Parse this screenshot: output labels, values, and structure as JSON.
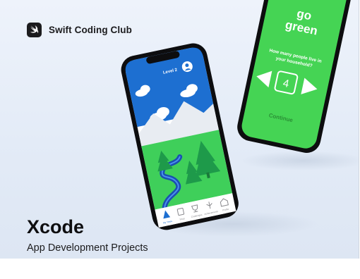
{
  "brand": {
    "name": "Swift Coding Club",
    "logo_icon": "swift-bird-icon"
  },
  "title": "Xcode",
  "subtitle": "App Development Projects",
  "back_phone": {
    "logo_line1": "go",
    "logo_line2": "green",
    "question_line1": "How many people live in",
    "question_line2": "your household?",
    "stepper_value": "4",
    "continue_label": "Continue",
    "screen_color": "#45d454"
  },
  "front_phone": {
    "level_label": "Level 2",
    "tabs": [
      "My Trees",
      "Shop",
      "Challenges",
      "Achievements",
      "Profile"
    ],
    "sky_color": "#1d6fd1",
    "grass_color": "#3fcf5a"
  }
}
